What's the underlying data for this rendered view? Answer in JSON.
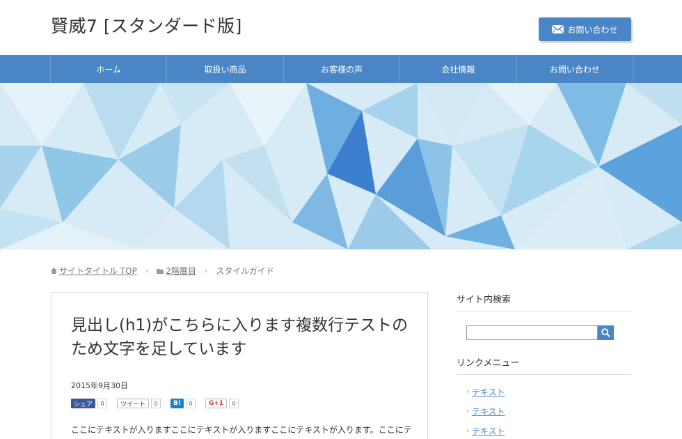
{
  "header": {
    "site_title": "賢威7 [スタンダード版]",
    "contact_button": {
      "label": "お問い合わせ",
      "icon": "mail-icon"
    }
  },
  "nav": {
    "items": [
      {
        "label": "ホーム"
      },
      {
        "label": "取扱い商品"
      },
      {
        "label": "お客様の声"
      },
      {
        "label": "会社情報"
      },
      {
        "label": "お問い合わせ"
      }
    ]
  },
  "breadcrumb": {
    "items": [
      {
        "label": "サイトタイトル TOP",
        "icon": "home-icon"
      },
      {
        "label": "2階層目",
        "icon": "folder-icon"
      },
      {
        "label": "スタイルガイド"
      }
    ]
  },
  "article": {
    "title": "見出し(h1)がこちらに入ります複数行テストのため文字を足しています",
    "date": "2015年9月30日",
    "share": [
      {
        "label": "シェア",
        "count": "0",
        "service": "facebook"
      },
      {
        "label": "ツイート",
        "count": "0",
        "service": "twitter"
      },
      {
        "label": "B!",
        "count": "0",
        "service": "hatena"
      },
      {
        "label": "G+1",
        "count": "0",
        "service": "google-plus"
      }
    ],
    "body": "ここにテキストが入りますここにテキストが入りますここにテキストが入ります。ここにテキストが入りますここにテキストが入りますここにテキストが入ります。"
  },
  "sidebar": {
    "search_title": "サイト内検索",
    "search_placeholder": "",
    "links_title": "リンクメニュー",
    "links": [
      {
        "label": "テキスト"
      },
      {
        "label": "テキスト"
      },
      {
        "label": "テキスト"
      }
    ]
  },
  "colors": {
    "accent": "#4a86c5",
    "hero_light": "#cfe6f3",
    "hero_dark": "#3d7fcf"
  }
}
